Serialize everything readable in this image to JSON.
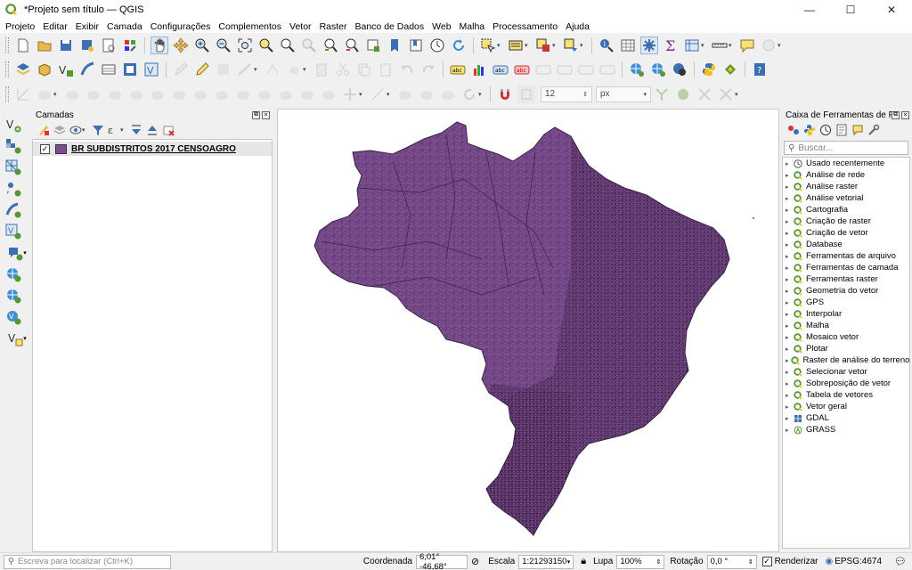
{
  "window": {
    "title": "*Projeto sem título — QGIS",
    "minimize": "—",
    "maximize": "☐",
    "close": "✕"
  },
  "menu": [
    "Projeto",
    "Editar",
    "Exibir",
    "Camada",
    "Configurações",
    "Complementos",
    "Vetor",
    "Raster",
    "Banco de Dados",
    "Web",
    "Malha",
    "Processamento",
    "Ajuda"
  ],
  "toolbar3": {
    "snap_tolerance": "12",
    "snap_unit": "px"
  },
  "layers_panel": {
    "title": "Camadas",
    "layers": [
      {
        "name": "BR SUBDISTRITOS 2017 CENSOAGRO",
        "checked": true,
        "color": "#7b4c8e"
      }
    ]
  },
  "toolbox": {
    "title": "Caixa de Ferramentas de Proc...",
    "search_placeholder": "Buscar...",
    "items": [
      {
        "label": "Usado recentemente",
        "icon": "clock-icon"
      },
      {
        "label": "Análise de rede",
        "icon": "qgis-q-icon"
      },
      {
        "label": "Análise raster",
        "icon": "qgis-q-icon"
      },
      {
        "label": "Análise vetorial",
        "icon": "qgis-q-icon"
      },
      {
        "label": "Cartografia",
        "icon": "qgis-q-icon"
      },
      {
        "label": "Criação de raster",
        "icon": "qgis-q-icon"
      },
      {
        "label": "Criação de vetor",
        "icon": "qgis-q-icon"
      },
      {
        "label": "Database",
        "icon": "qgis-q-icon"
      },
      {
        "label": "Ferramentas de arquivo",
        "icon": "qgis-q-icon"
      },
      {
        "label": "Ferramentas de camada",
        "icon": "qgis-q-icon"
      },
      {
        "label": "Ferramentas raster",
        "icon": "qgis-q-icon"
      },
      {
        "label": "Geometria do vetor",
        "icon": "qgis-q-icon"
      },
      {
        "label": "GPS",
        "icon": "qgis-q-icon"
      },
      {
        "label": "Interpolar",
        "icon": "qgis-q-icon"
      },
      {
        "label": "Malha",
        "icon": "qgis-q-icon"
      },
      {
        "label": "Mosaico vetor",
        "icon": "qgis-q-icon"
      },
      {
        "label": "Plotar",
        "icon": "qgis-q-icon"
      },
      {
        "label": "Raster de análise do terreno",
        "icon": "qgis-q-icon"
      },
      {
        "label": "Selecionar vetor",
        "icon": "qgis-q-icon"
      },
      {
        "label": "Sobreposição de vetor",
        "icon": "qgis-q-icon"
      },
      {
        "label": "Tabela de vetores",
        "icon": "qgis-q-icon"
      },
      {
        "label": "Vetor geral",
        "icon": "qgis-q-icon"
      },
      {
        "label": "GDAL",
        "icon": "gdal-icon"
      },
      {
        "label": "GRASS",
        "icon": "grass-icon"
      }
    ]
  },
  "statusbar": {
    "locator_placeholder": "Escreva para localizar (Ctrl+K)",
    "coord_label": "Coordenada",
    "coord_value": "6,01° -46,68°",
    "scale_label": "Escala",
    "scale_value": "1:21293150",
    "magnifier_label": "Lupa",
    "magnifier_value": "100%",
    "rotation_label": "Rotação",
    "rotation_value": "0,0 °",
    "render_label": "Renderizar",
    "render_checked": true,
    "crs": "EPSG:4674"
  },
  "colors": {
    "map_fill": "#7b4c8e",
    "map_line": "#3a2345",
    "qgis_green": "#589632"
  }
}
